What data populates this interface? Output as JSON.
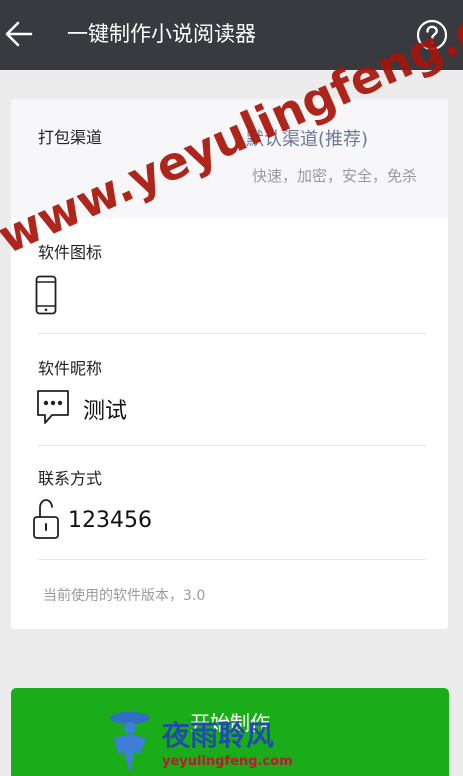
{
  "header": {
    "title": "一键制作小说阅读器",
    "back_icon": "back-arrow-icon",
    "help_icon": "help-circle-icon"
  },
  "form": {
    "channel": {
      "label": "打包渠道",
      "value": "默认渠道(推荐)",
      "description": "快速，加密，安全，免杀"
    },
    "software_icon": {
      "label": "软件图标",
      "icon": "phone-icon"
    },
    "nickname": {
      "label": "软件昵称",
      "icon": "chat-bubble-icon",
      "value": "测试"
    },
    "contact": {
      "label": "联系方式",
      "icon": "unlock-icon",
      "value": "123456"
    },
    "version_note": "当前使用的软件版本，3.0"
  },
  "footer": {
    "start_button_label": "开始制作"
  },
  "watermark": {
    "text": "www.yeyulingfeng.com",
    "logo_cn": "夜雨聆风",
    "logo_en": "yeyulingfeng.com"
  },
  "colors": {
    "appbar": "#393a3f",
    "primary_button": "#1aad19",
    "link_text": "#6a7999",
    "watermark": "#a8140a"
  }
}
